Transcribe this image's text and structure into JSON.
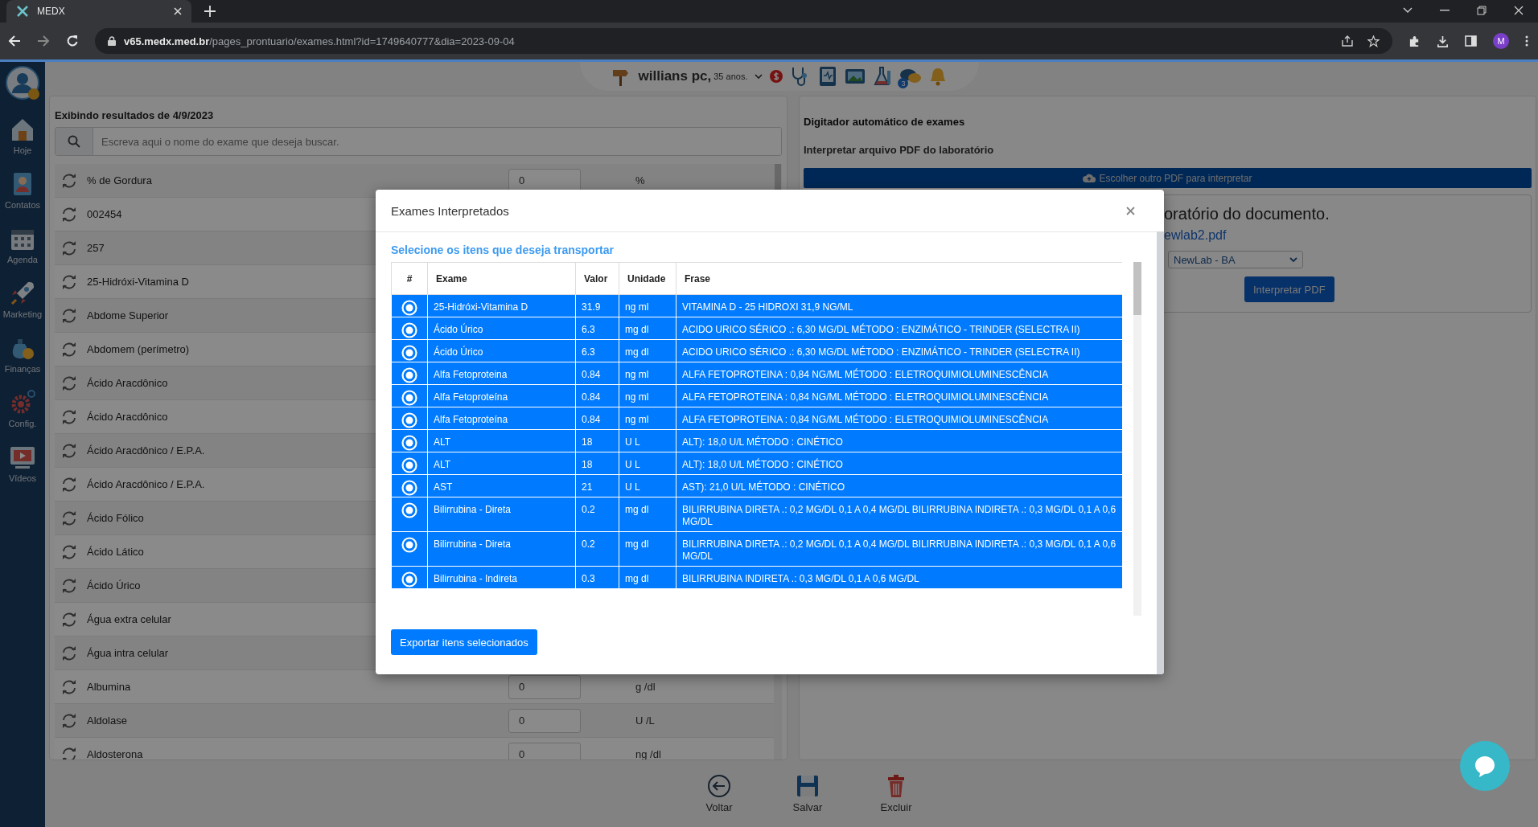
{
  "browser": {
    "tab_title": "MEDX",
    "url_host": "v65.medx.med.br",
    "url_path": "/pages_prontuario/exames.html?id=1749640777&dia=2023-09-04",
    "profile_initial": "M"
  },
  "sidebar": {
    "items": [
      {
        "label": "Hoje"
      },
      {
        "label": "Contatos"
      },
      {
        "label": "Agenda"
      },
      {
        "label": "Marketing"
      },
      {
        "label": "Finanças"
      },
      {
        "label": "Config."
      },
      {
        "label": "Vídeos"
      }
    ]
  },
  "header": {
    "patient": "willians pc,",
    "age": "35 anos.",
    "chat_badge": "3"
  },
  "exam_list": {
    "title": "Exibindo resultados de 4/9/2023",
    "search_placeholder": "Escreva aqui o nome do exame que deseja buscar.",
    "rows": [
      {
        "name": "% de Gordura",
        "value": "0",
        "unit": "%"
      },
      {
        "name": "002454"
      },
      {
        "name": "257"
      },
      {
        "name": "25-Hidróxi-Vitamina D"
      },
      {
        "name": "Abdome Superior"
      },
      {
        "name": "Abdomem (perímetro)"
      },
      {
        "name": "Ácido Aracdônico"
      },
      {
        "name": "Ácido Aracdônico"
      },
      {
        "name": "Ácido Aracdônico / E.P.A."
      },
      {
        "name": "Ácido Aracdônico / E.P.A."
      },
      {
        "name": "Ácido Fólico"
      },
      {
        "name": "Ácido Lático"
      },
      {
        "name": "Ácido Úrico"
      },
      {
        "name": "Água extra celular"
      },
      {
        "name": "Água intra celular"
      },
      {
        "name": "Albumina",
        "value": "0",
        "unit": "g /dl"
      },
      {
        "name": "Aldolase",
        "value": "0",
        "unit": "U /L"
      },
      {
        "name": "Aldosterona",
        "value": "0",
        "unit": "ng /dl"
      }
    ]
  },
  "auto_typer": {
    "title": "Digitador automático de exames",
    "subtitle": "Interpretar arquivo PDF do laboratório",
    "choose_button": "Escolher outro PDF para interpretar",
    "heading": "oratório do documento.",
    "file_link": "ewlab2.pdf",
    "lab_select": "NewLab - BA",
    "interpret_button": "Interpretar PDF"
  },
  "modal": {
    "title": "Exames Interpretados",
    "subtitle": "Selecione os itens que deseja transportar",
    "columns": [
      "#",
      "Exame",
      "Valor",
      "Unidade",
      "Frase"
    ],
    "rows": [
      {
        "selected": true,
        "exam": "25-Hidróxi-Vitamina D",
        "value": "31.9",
        "unit": "ng ml",
        "phrase": "VITAMINA D - 25 HIDROXI 31,9 NG/ML"
      },
      {
        "selected": true,
        "exam": "Ácido Úrico",
        "value": "6.3",
        "unit": "mg dl",
        "phrase": "ACIDO URICO SÉRICO .: 6,30 MG/DL MÉTODO : ENZIMÁTICO - TRINDER (SELECTRA II)"
      },
      {
        "selected": true,
        "exam": "Ácido Úrico",
        "value": "6.3",
        "unit": "mg dl",
        "phrase": "ACIDO URICO SÉRICO .: 6,30 MG/DL MÉTODO : ENZIMÁTICO - TRINDER (SELECTRA II)"
      },
      {
        "selected": true,
        "exam": "Alfa Fetoproteina",
        "value": "0.84",
        "unit": "ng ml",
        "phrase": "ALFA FETOPROTEINA : 0,84 NG/ML MÉTODO : ELETROQUIMIOLUMINESCÊNCIA"
      },
      {
        "selected": true,
        "exam": "Alfa Fetoproteína",
        "value": "0.84",
        "unit": "ng ml",
        "phrase": "ALFA FETOPROTEINA : 0,84 NG/ML MÉTODO : ELETROQUIMIOLUMINESCÊNCIA"
      },
      {
        "selected": true,
        "exam": "Alfa Fetoproteína",
        "value": "0.84",
        "unit": "ng ml",
        "phrase": "ALFA FETOPROTEINA : 0,84 NG/ML MÉTODO : ELETROQUIMIOLUMINESCÊNCIA"
      },
      {
        "selected": true,
        "exam": "ALT",
        "value": "18",
        "unit": "U L",
        "phrase": "ALT): 18,0 U/L MÉTODO : CINÉTICO"
      },
      {
        "selected": true,
        "exam": "ALT",
        "value": "18",
        "unit": "U L",
        "phrase": "ALT): 18,0 U/L MÉTODO : CINÉTICO"
      },
      {
        "selected": true,
        "exam": "AST",
        "value": "21",
        "unit": "U L",
        "phrase": "AST): 21,0 U/L MÉTODO : CINÉTICO"
      },
      {
        "selected": true,
        "exam": "Bilirrubina - Direta",
        "value": "0.2",
        "unit": "mg dl",
        "phrase": "BILIRRUBINA DIRETA .: 0,2 MG/DL 0,1 A 0,4 MG/DL BILIRRUBINA INDIRETA .: 0,3 MG/DL 0,1 A 0,6 MG/DL"
      },
      {
        "selected": true,
        "exam": "Bilirrubina - Direta",
        "value": "0.2",
        "unit": "mg dl",
        "phrase": "BILIRRUBINA DIRETA .: 0,2 MG/DL 0,1 A 0,4 MG/DL BILIRRUBINA INDIRETA .: 0,3 MG/DL 0,1 A 0,6 MG/DL"
      },
      {
        "selected": true,
        "exam": "Bilirrubina - Indireta",
        "value": "0.3",
        "unit": "mg dl",
        "phrase": "BILIRRUBINA INDIRETA .: 0,3 MG/DL 0,1 A 0,6 MG/DL"
      }
    ],
    "export_button": "Exportar itens selecionados"
  },
  "footer": {
    "buttons": [
      "Voltar",
      "Salvar",
      "Excluir"
    ]
  }
}
